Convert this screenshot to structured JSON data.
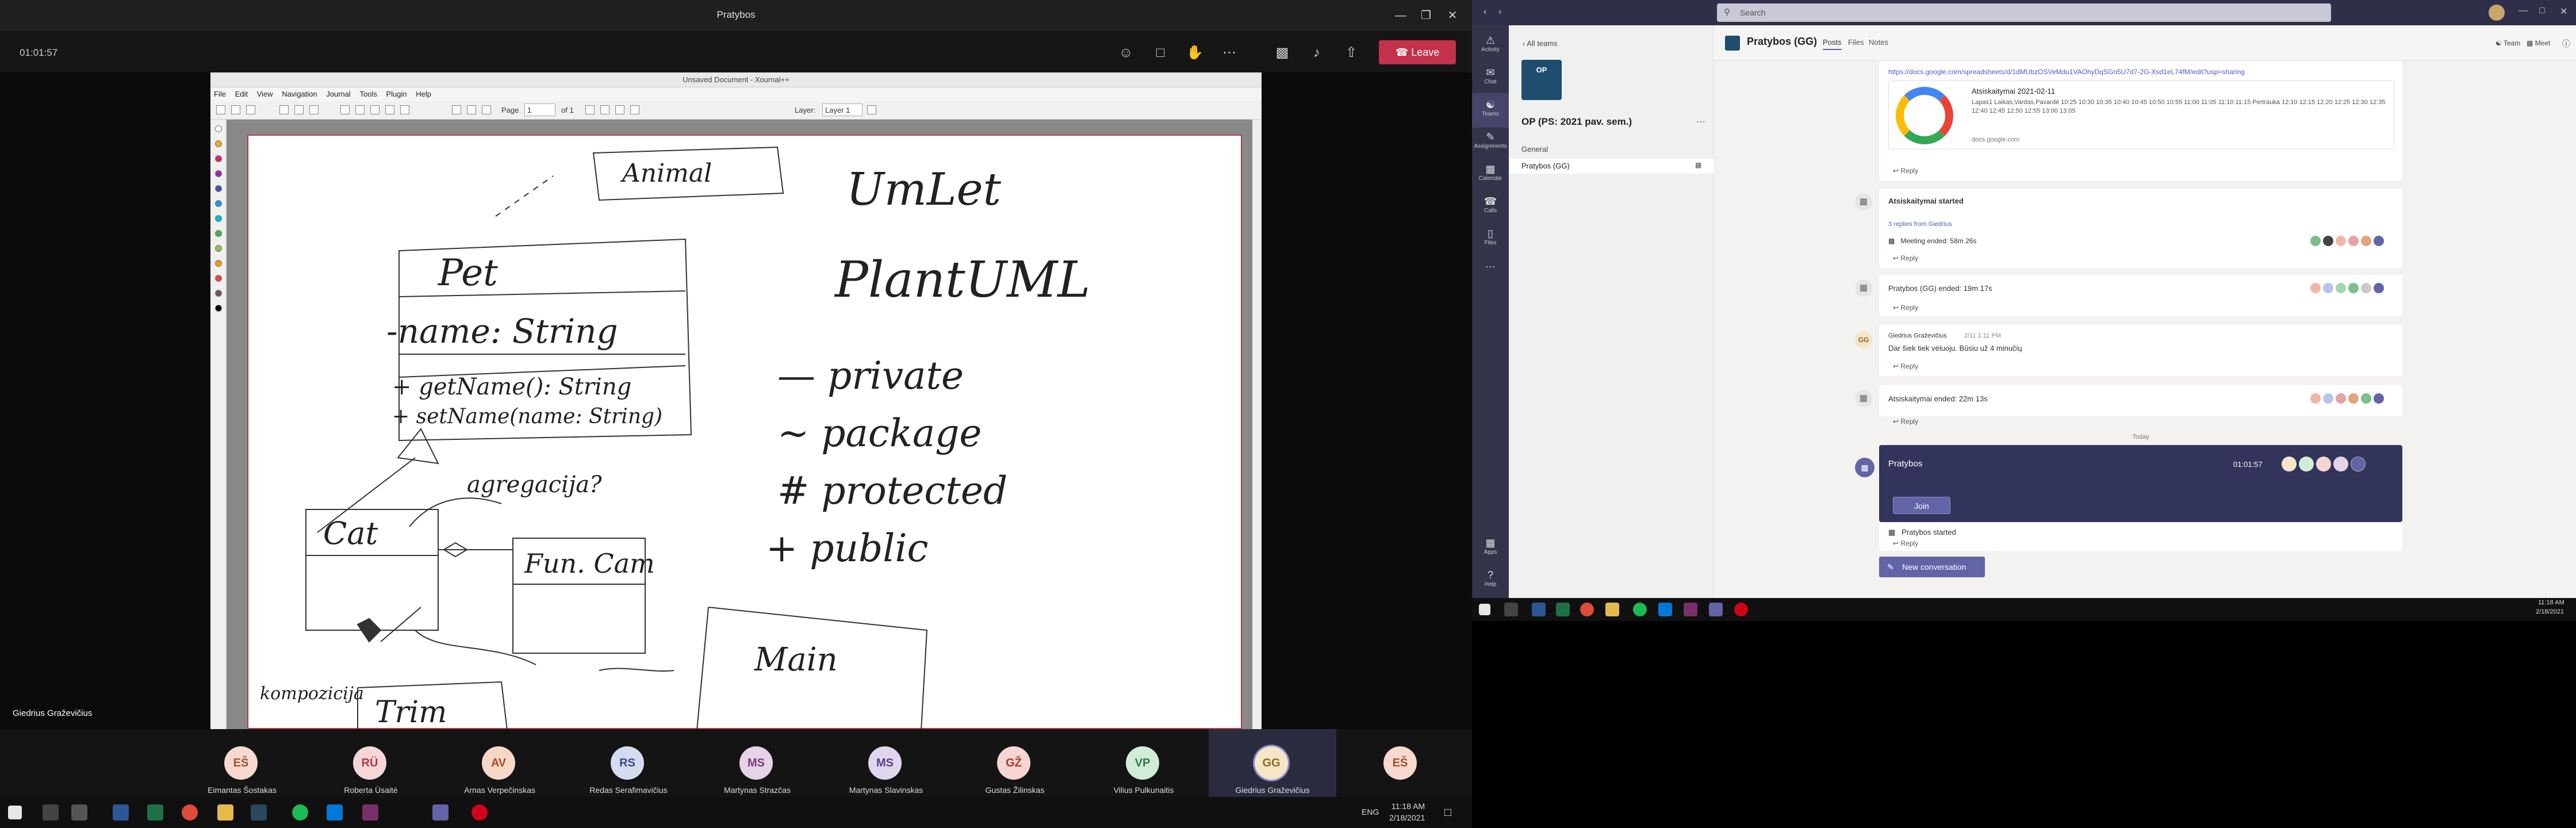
{
  "meeting": {
    "window_title": "Pratybos",
    "timer": "01:01:57",
    "leave_label": "Leave",
    "presenter_name": "Giedrius Graževičius"
  },
  "xournal": {
    "title": "Unsaved Document - Xournal++",
    "menu": [
      "File",
      "Edit",
      "View",
      "Navigation",
      "Journal",
      "Tools",
      "Plugin",
      "Help"
    ],
    "page_label": "Page",
    "page_value": "1",
    "page_of": "of 1",
    "layer_label": "Layer:",
    "layer_value": "Layer 1",
    "sketch_texts": {
      "animal": "Animal",
      "uml": "UmLet",
      "plantuml": "PlantUML",
      "pet": "Pet",
      "name_attr": "-name: String",
      "get_name": "+ getName(): String",
      "set_name": "+ setName(name: String)",
      "private": "— private",
      "package": "~ package",
      "protected": "# protected",
      "public": "+ public",
      "agregacija": "agregacija?",
      "cat": "Cat",
      "fun_cam": "Fun. Cam",
      "main": "Main",
      "trim": "Trim",
      "kompozicija": "kompozicija"
    },
    "colors": [
      "#ffffff",
      "#f5a623",
      "#e91e63",
      "#9c27b0",
      "#3f51b5",
      "#2196f3",
      "#00bcd4",
      "#4caf50",
      "#8bc34a",
      "#ff9800",
      "#f44336",
      "#795548",
      "#000000"
    ]
  },
  "participants": [
    {
      "initials": "EŠ",
      "name": "Eimantas Šostakas",
      "color": "#f7d9cf",
      "fg": "#a0522d"
    },
    {
      "initials": "RÜ",
      "name": "Roberta Üsaitė",
      "color": "#f6d6d9",
      "fg": "#b03a48"
    },
    {
      "initials": "AV",
      "name": "Arnas Verpečinskas",
      "color": "#f7d8c8",
      "fg": "#b04a20"
    },
    {
      "initials": "RS",
      "name": "Redas Serafimavičius",
      "color": "#d6dcf0",
      "fg": "#3a4a8a"
    },
    {
      "initials": "MS",
      "name": "Martynas Strazčas",
      "color": "#e5d3e6",
      "fg": "#7a3a7e"
    },
    {
      "initials": "MS",
      "name": "Martynas Slavinskas",
      "color": "#e0d7ef",
      "fg": "#5a3f8e"
    },
    {
      "initials": "GŽ",
      "name": "Gustas Žilinskas",
      "color": "#f7d5d2",
      "fg": "#b0382c"
    },
    {
      "initials": "VP",
      "name": "Vilius Pulkunaitis",
      "color": "#d3ecd9",
      "fg": "#2f7a45"
    },
    {
      "initials": "GG",
      "name": "Giedrius Graževičius",
      "color": "#f5e6c8",
      "fg": "#8a6a20"
    },
    {
      "initials": "EŠ",
      "name": "",
      "color": "#f7d9cf",
      "fg": "#a0522d"
    }
  ],
  "taskbar_left": {
    "time": "11:18 AM",
    "date": "2/18/2021",
    "lang": "ENG"
  },
  "taskbar_right": {
    "time": "11:18 AM",
    "date": "2/18/2021"
  },
  "teams": {
    "search_placeholder": "Search",
    "rail": [
      "Activity",
      "Chat",
      "Teams",
      "Assignments",
      "Calendar",
      "Calls",
      "Files",
      "Apps",
      "Help"
    ],
    "all_teams": "All teams",
    "team_name": "OP (PS: 2021 pav. sem.)",
    "team_logo_text": "OP",
    "channels": [
      "General",
      "Pratybos (GG)"
    ],
    "channel_title": "Pratybos (GG)",
    "tabs": [
      "Posts",
      "Files",
      "Notes"
    ],
    "team_btn": "Team",
    "meet_btn": "Meet",
    "link_url": "https://docs.google.com/spreadsheets/d/1dMUbzOSVeMdu1VAOhyDqSGn5U7d7-2G-Xsd1eL74fM/edit?usp=sharing",
    "link_card_title": "Atsiskaitymai 2021-02-11",
    "link_card_desc": "Lapas1 Laikas,Vardas,Pavardė 10:25 10:30 10:35 10:40 10:45 10:50 10:55 11:00 11:05 11:10 11:15 Pertrauka 12:10 12:15 12:20 12:25 12:30 12:35 12:40 12:45 12:50 12:55 13:00 13:05",
    "link_card_domain": "docs.google.com",
    "reply": "Reply",
    "post1_title": "Atsiskaitymai started",
    "post1_replies": "3 replies from Giedrius",
    "post1_ended": "Meeting ended: 58m 26s",
    "post2_title": "Pratybos (GG) ended: 19m 17s",
    "post3_author": "Giedrius Graževičius",
    "post3_time": "2/11 1:11 PM",
    "post3_text": "Dar šiek tiek vėluoju. Būsiu už 4 minučių",
    "post3_av": "GG",
    "post4_title": "Atsiskaitymai ended: 22m 13s",
    "divider": "Today",
    "live_title": "Pratybos",
    "live_timer": "01:01:57",
    "join_label": "Join",
    "live_started": "Pratybos started",
    "new_conversation": "New conversation"
  }
}
